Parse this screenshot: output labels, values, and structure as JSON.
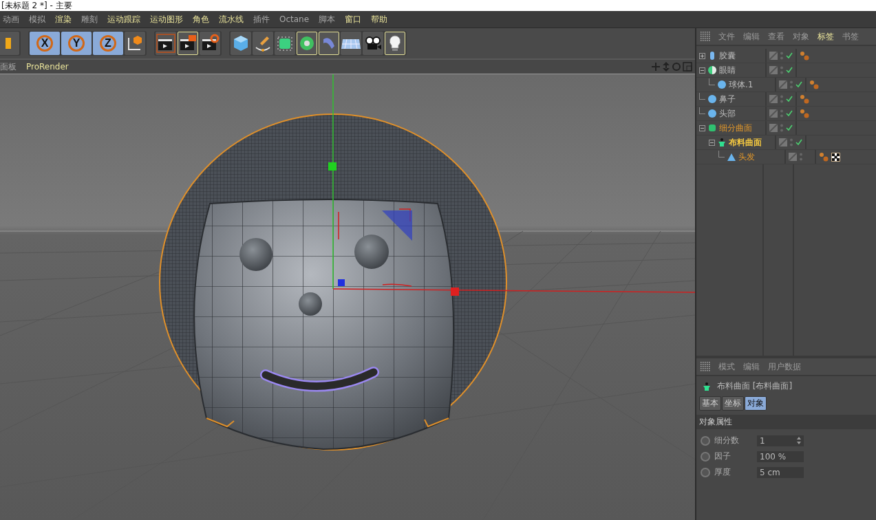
{
  "window": {
    "title": "[未标题 2 *] - 主要"
  },
  "menu": [
    {
      "label": "动画",
      "highlighted": false
    },
    {
      "label": "模拟",
      "highlighted": false
    },
    {
      "label": "渲染",
      "highlighted": true
    },
    {
      "label": "雕刻",
      "highlighted": false
    },
    {
      "label": "运动跟踪",
      "highlighted": true
    },
    {
      "label": "运动图形",
      "highlighted": true
    },
    {
      "label": "角色",
      "highlighted": true
    },
    {
      "label": "流水线",
      "highlighted": true
    },
    {
      "label": "插件",
      "highlighted": false
    },
    {
      "label": "Octane",
      "highlighted": false
    },
    {
      "label": "脚本",
      "highlighted": false
    },
    {
      "label": "窗口",
      "highlighted": true
    },
    {
      "label": "帮助",
      "highlighted": true
    }
  ],
  "toolbar_groups": [
    {
      "items": [
        {
          "kind": "partial",
          "selected": false
        }
      ]
    },
    {
      "items": [
        {
          "kind": "axis",
          "label": "X",
          "selected": true
        },
        {
          "kind": "axis",
          "label": "Y",
          "selected": true
        },
        {
          "kind": "axis",
          "label": "Z",
          "selected": true
        },
        {
          "kind": "coords",
          "selected": false
        }
      ]
    },
    {
      "items": [
        {
          "kind": "render-view",
          "selected": false
        },
        {
          "kind": "render-picture",
          "selected": true
        },
        {
          "kind": "render-settings",
          "selected": false
        }
      ]
    },
    {
      "items": [
        {
          "kind": "cube",
          "selected": false
        },
        {
          "kind": "pen",
          "selected": false
        },
        {
          "kind": "subdiv",
          "selected": false
        },
        {
          "kind": "cloner",
          "selected": true
        },
        {
          "kind": "deformer",
          "selected": true
        },
        {
          "kind": "floor",
          "selected": false
        },
        {
          "kind": "camera",
          "selected": false
        },
        {
          "kind": "light",
          "selected": true
        }
      ]
    }
  ],
  "viewport": {
    "menu": [
      {
        "label": "面板",
        "highlighted": false
      },
      {
        "label": "ProRender",
        "highlighted": true
      }
    ]
  },
  "object_manager": {
    "menu": [
      {
        "label": "文件",
        "selected": false
      },
      {
        "label": "编辑",
        "selected": false
      },
      {
        "label": "查看",
        "selected": false
      },
      {
        "label": "对象",
        "selected": false
      },
      {
        "label": "标签",
        "selected": true
      },
      {
        "label": "书签",
        "selected": false
      }
    ],
    "objects": [
      {
        "name": "胶囊",
        "kind": "capsule",
        "expanded": false,
        "selected": false,
        "active": false,
        "checked": true,
        "material_tag": true,
        "texture_tag": false
      },
      {
        "name": "眼睛",
        "kind": "half-sphere",
        "expanded": true,
        "selected": false,
        "active": false,
        "checked": true,
        "material_tag": false,
        "texture_tag": false,
        "children": [
          {
            "name": "球体.1",
            "kind": "sphere",
            "selected": false,
            "active": false,
            "checked": true,
            "material_tag": true,
            "texture_tag": false
          }
        ]
      },
      {
        "name": "鼻子",
        "kind": "sphere",
        "selected": false,
        "active": false,
        "checked": true,
        "material_tag": true,
        "texture_tag": false
      },
      {
        "name": "头部",
        "kind": "sphere",
        "selected": false,
        "active": false,
        "checked": true,
        "material_tag": true,
        "texture_tag": false
      },
      {
        "name": "细分曲面",
        "kind": "subdiv",
        "expanded": true,
        "selected": true,
        "active": false,
        "checked": true,
        "material_tag": false,
        "texture_tag": false,
        "children": [
          {
            "name": "布料曲面",
            "kind": "cloth",
            "expanded": true,
            "selected": true,
            "active": true,
            "checked": true,
            "material_tag": false,
            "texture_tag": false,
            "children": [
              {
                "name": "头发",
                "kind": "hair",
                "selected": true,
                "active": false,
                "checked": false,
                "material_tag": true,
                "texture_tag": true
              }
            ]
          }
        ]
      }
    ]
  },
  "attributes": {
    "menu": [
      "模式",
      "编辑",
      "用户数据"
    ],
    "object_title": "布料曲面 [布料曲面]",
    "tabs": [
      {
        "label": "基本",
        "selected": false
      },
      {
        "label": "坐标",
        "selected": false
      },
      {
        "label": "对象",
        "selected": true
      }
    ],
    "section": "对象属性",
    "fields": [
      {
        "label": "细分数",
        "value": "1",
        "kind": "spinner",
        "checked": false
      },
      {
        "label": "因子",
        "value": "100 %",
        "kind": "plain",
        "checked": false
      },
      {
        "label": "厚度",
        "value": "5 cm",
        "kind": "plain",
        "checked": false
      }
    ]
  }
}
